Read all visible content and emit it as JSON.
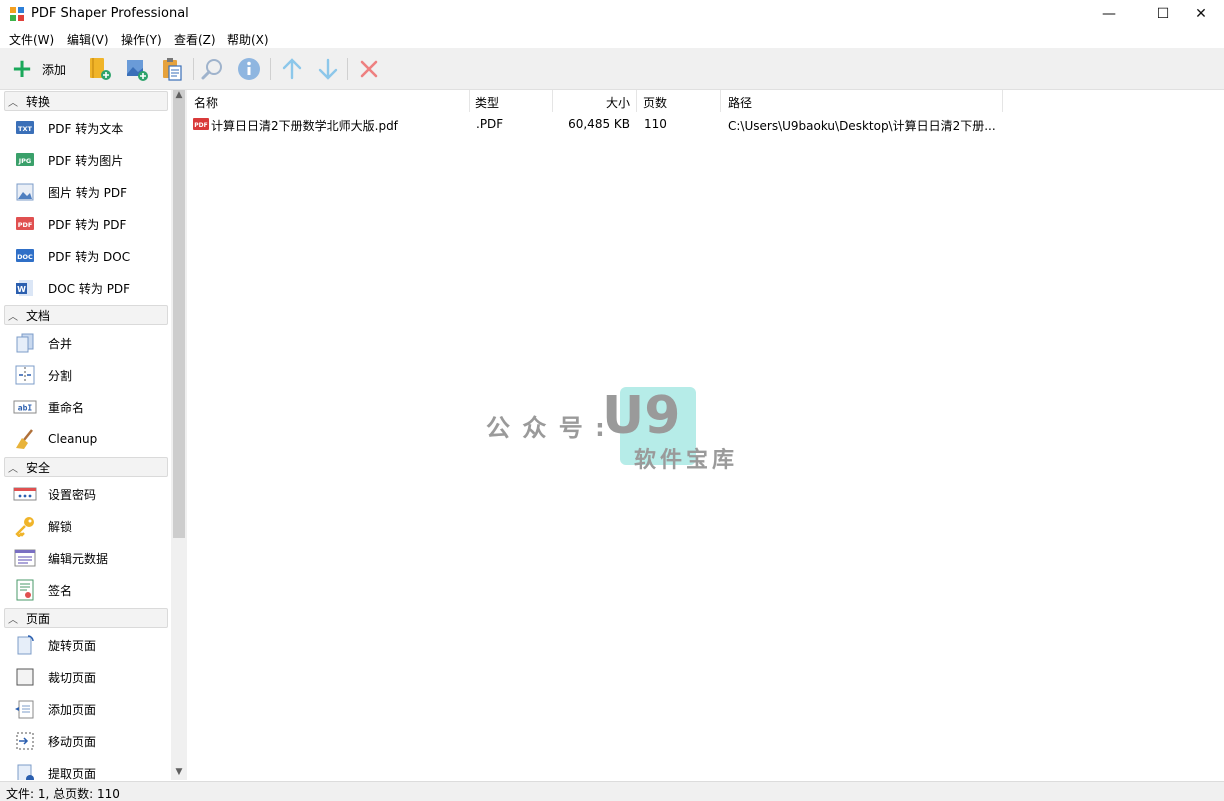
{
  "window": {
    "title": "PDF Shaper Professional",
    "minimize": "—",
    "maximize": "☐",
    "close": "✕"
  },
  "menu": [
    "文件(W)",
    "编辑(V)",
    "操作(Y)",
    "查看(Z)",
    "帮助(X)"
  ],
  "toolbar": {
    "add_label": "添加",
    "icons": [
      "add-folder-icon",
      "add-image-icon",
      "paste-icon",
      "search-icon",
      "info-icon",
      "move-up-icon",
      "move-down-icon",
      "remove-icon"
    ]
  },
  "sidebar": {
    "sections": [
      {
        "title": "转换",
        "items": [
          {
            "label": "PDF 转为文本",
            "icon": "txt"
          },
          {
            "label": "PDF 转为图片",
            "icon": "jpg"
          },
          {
            "label": "图片 转为 PDF",
            "icon": "image"
          },
          {
            "label": "PDF 转为 PDF",
            "icon": "pdf"
          },
          {
            "label": "PDF 转为 DOC",
            "icon": "doc"
          },
          {
            "label": "DOC 转为 PDF",
            "icon": "word"
          }
        ]
      },
      {
        "title": "文档",
        "items": [
          {
            "label": "合并",
            "icon": "merge"
          },
          {
            "label": "分割",
            "icon": "split"
          },
          {
            "label": "重命名",
            "icon": "rename"
          },
          {
            "label": "Cleanup",
            "icon": "broom"
          }
        ]
      },
      {
        "title": "安全",
        "items": [
          {
            "label": "设置密码",
            "icon": "password"
          },
          {
            "label": "解锁",
            "icon": "key"
          },
          {
            "label": "编辑元数据",
            "icon": "metadata"
          },
          {
            "label": "签名",
            "icon": "signature"
          }
        ]
      },
      {
        "title": "页面",
        "items": [
          {
            "label": "旋转页面",
            "icon": "rotate"
          },
          {
            "label": "裁切页面",
            "icon": "crop"
          },
          {
            "label": "添加页面",
            "icon": "add-page"
          },
          {
            "label": "移动页面",
            "icon": "move-page"
          },
          {
            "label": "提取页面",
            "icon": "extract-page"
          }
        ]
      }
    ]
  },
  "file_list": {
    "columns": [
      "名称",
      "类型",
      "大小",
      "页数",
      "路径"
    ],
    "rows": [
      {
        "name": "计算日日清2下册数学北师大版.pdf",
        "type": ".PDF",
        "size": "60,485 KB",
        "pages": "110",
        "path": "C:\\Users\\U9baoku\\Desktop\\计算日日清2下册..."
      }
    ]
  },
  "watermark": {
    "prefix": "公 众 号 :",
    "logo": "U9",
    "subtitle": "软件宝库"
  },
  "status": {
    "text": "文件: 1, 总页数: 110"
  }
}
